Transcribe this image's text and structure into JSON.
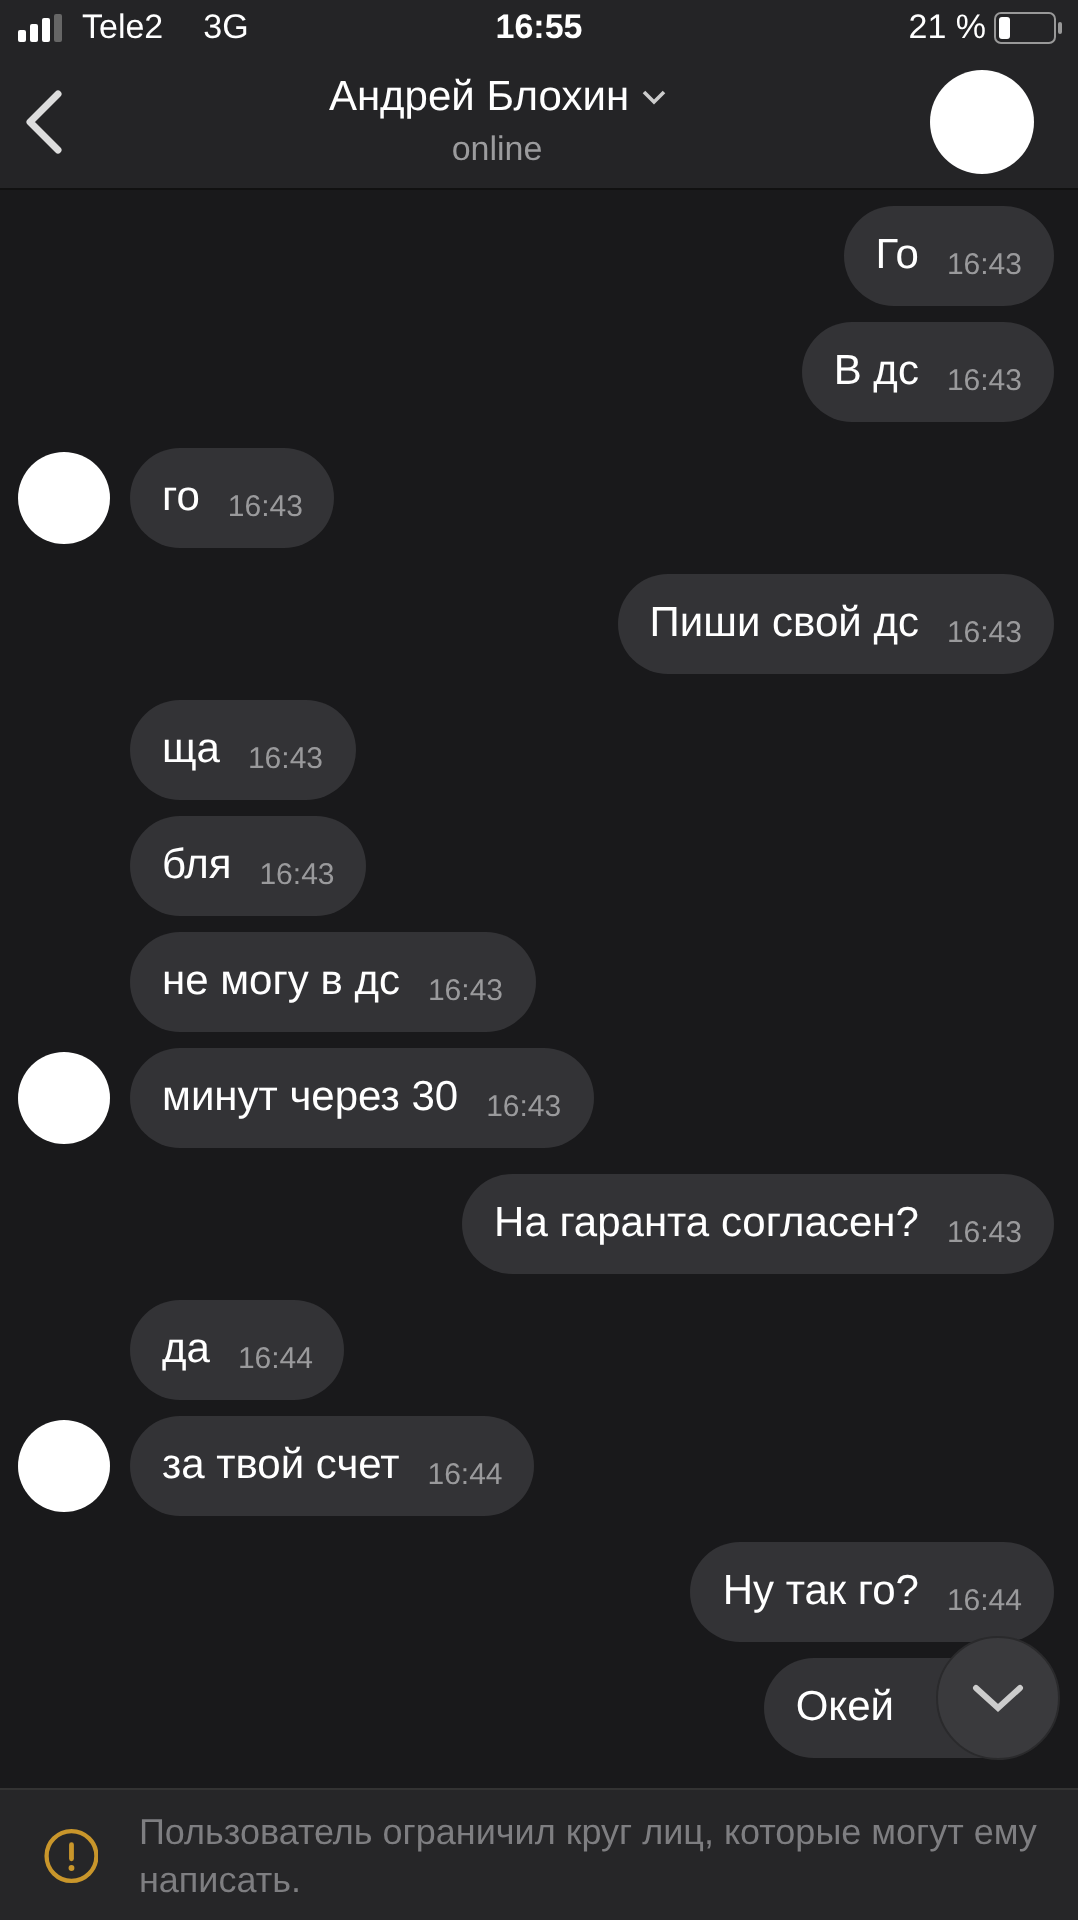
{
  "status_bar": {
    "carrier": "Tele2",
    "network": "3G",
    "time": "16:55",
    "battery_text": "21 %"
  },
  "header": {
    "name": "Андрей Блохин",
    "status": "online"
  },
  "messages": [
    {
      "outgoing": true,
      "text": "Го",
      "time": "16:43"
    },
    {
      "outgoing": true,
      "text": "В дс",
      "time": "16:43"
    },
    {
      "outgoing": false,
      "avatar": true,
      "text": "го",
      "time": "16:43"
    },
    {
      "outgoing": true,
      "text": "Пиши свой дс",
      "time": "16:43"
    },
    {
      "outgoing": false,
      "avatar": false,
      "text": "ща",
      "time": "16:43"
    },
    {
      "outgoing": false,
      "avatar": false,
      "text": "бля",
      "time": "16:43"
    },
    {
      "outgoing": false,
      "avatar": false,
      "text": "не могу в дс",
      "time": "16:43"
    },
    {
      "outgoing": false,
      "avatar": true,
      "text": "минут через 30",
      "time": "16:43"
    },
    {
      "outgoing": true,
      "text": "На гаранта согласен?",
      "time": "16:43"
    },
    {
      "outgoing": false,
      "avatar": false,
      "text": "да",
      "time": "16:44"
    },
    {
      "outgoing": false,
      "avatar": true,
      "text": "за твой счет",
      "time": "16:44"
    },
    {
      "outgoing": true,
      "text": "Ну так го?",
      "time": "16:44"
    },
    {
      "outgoing": true,
      "text": "Окей"
    }
  ],
  "notice": {
    "text": "Пользователь ограничил круг лиц, которые могут ему написать."
  }
}
